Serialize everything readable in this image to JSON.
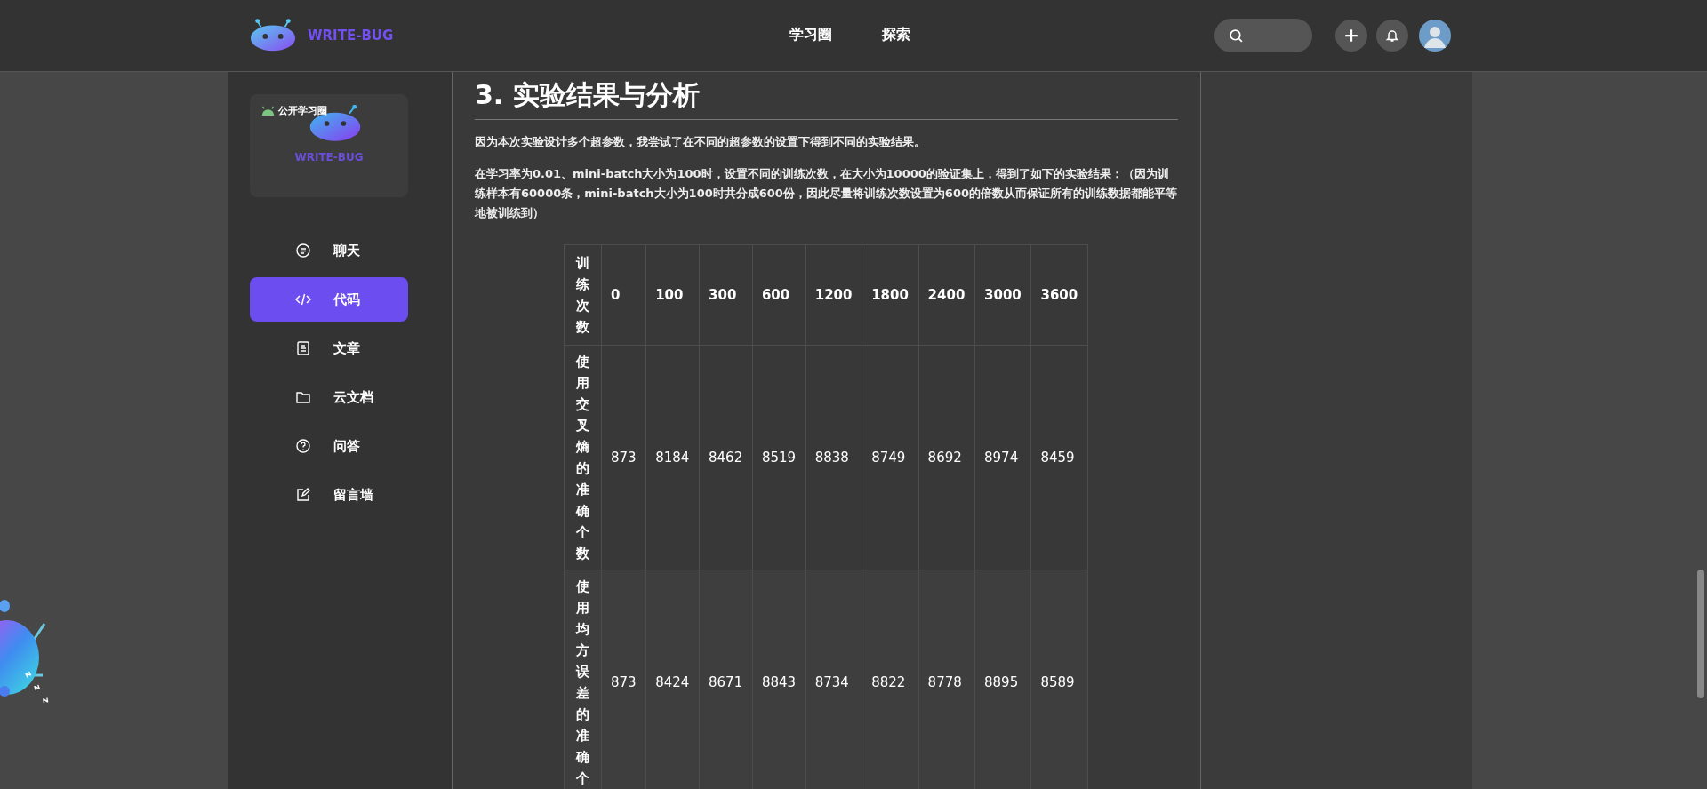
{
  "header": {
    "brand": "WRITE-BUG",
    "nav": [
      {
        "label": "学习圈",
        "selected": false
      },
      {
        "label": "探索",
        "selected": false
      }
    ]
  },
  "sidebar": {
    "card": {
      "badge": "公开学习圈",
      "logo_text": "WRITE-BUG"
    },
    "items": [
      {
        "label": "聊天",
        "selected": false
      },
      {
        "label": "代码",
        "selected": true
      },
      {
        "label": "文章",
        "selected": false
      },
      {
        "label": "云文档",
        "selected": false
      },
      {
        "label": "问答",
        "selected": false
      },
      {
        "label": "留言墙",
        "selected": false
      }
    ]
  },
  "article": {
    "heading": "3. 实验结果与分析",
    "paragraphs": [
      "因为本次实验设计多个超参数，我尝试了在不同的超参数的设置下得到不同的实验结果。",
      "在学习率为0.01、mini-batch大小为100时，设置不同的训练次数，在大小为10000的验证集上，得到了如下的实验结果：（因为训练样本有60000条，mini-batch大小为100时共分成600份，因此尽量将训练次数设置为600的倍数从而保证所有的训练数据都能平等地被训练到）"
    ],
    "table": {
      "columns": [
        "训练次数",
        "0",
        "100",
        "300",
        "600",
        "1200",
        "1800",
        "2400",
        "3000",
        "3600"
      ],
      "rows": [
        [
          "使用交叉熵的准确个数",
          "873",
          "8184",
          "8462",
          "8519",
          "8838",
          "8749",
          "8692",
          "8974",
          "8459"
        ],
        [
          "使用均方误差的准确个",
          "873",
          "8424",
          "8671",
          "8843",
          "8734",
          "8822",
          "8778",
          "8895",
          "8589"
        ]
      ]
    }
  },
  "mascot": {
    "sleep_marks": [
      "z",
      "z",
      "z"
    ]
  }
}
